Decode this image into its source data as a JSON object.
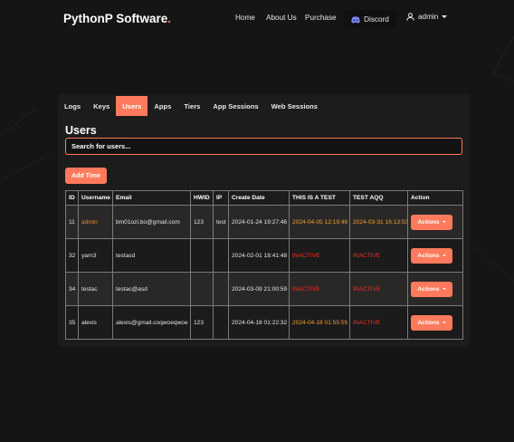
{
  "nav": {
    "brand": "PythonP Software",
    "brand_dot": ".",
    "links": [
      "Home",
      "About Us",
      "Purchase"
    ],
    "discord_label": "Discord",
    "user_label": "admin"
  },
  "tabs": [
    "Logs",
    "Keys",
    "Users",
    "Apps",
    "Tiers",
    "App Sessions",
    "Web Sessions"
  ],
  "active_tab": "Users",
  "section_title": "Users",
  "search": {
    "placeholder": "Search for users..."
  },
  "add_button": "Add Time",
  "table": {
    "headers": [
      "ID",
      "Username",
      "Email",
      "HWID",
      "IP",
      "Create Date",
      "THIS IS A TEST",
      "TEST AQQ",
      "Action"
    ],
    "rows": [
      {
        "id": "11",
        "username": "admin",
        "email": "bm01ozl.bo@gmail.com",
        "hwid": "123",
        "ip": "test",
        "create_date": "2024-01-24 19:27:46",
        "test1": "2024-04-05 12:19:46",
        "test2": "2024-03-31 16:13:53",
        "action": "Actions"
      },
      {
        "id": "32",
        "username": "yarn3",
        "email": "testasd",
        "hwid": "",
        "ip": "",
        "create_date": "2024-02-01 18:41:48",
        "test1": "INACTIVE",
        "test2": "INACTIVE",
        "action": "Actions"
      },
      {
        "id": "34",
        "username": "testac",
        "email": "testac@asd",
        "hwid": "",
        "ip": "",
        "create_date": "2024-03-09 21:00:59",
        "test1": "INACTIVE",
        "test2": "INACTIVE",
        "action": "Actions"
      },
      {
        "id": "35",
        "username": "alexis",
        "email": "alexis@gmail.coqwoeqwoe",
        "hwid": "123",
        "ip": "",
        "create_date": "2024-04-18 01:22:32",
        "test1": "2024-04-18 01:55:55",
        "test2": "INACTIVE",
        "action": "Actions"
      }
    ]
  },
  "colors": {
    "accent": "#ff7a5c",
    "background": "#151515",
    "active_date": "#f0a030",
    "inactive": "#ff2a1a"
  }
}
